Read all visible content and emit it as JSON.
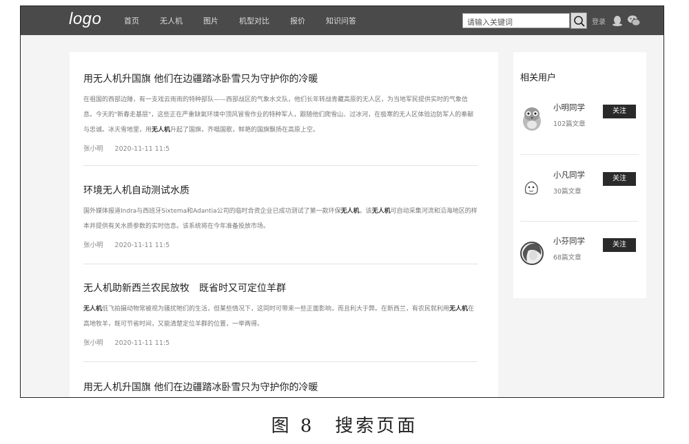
{
  "header": {
    "logo": "logo",
    "nav": [
      "首页",
      "无人机",
      "图片",
      "机型对比",
      "报价",
      "知识问答"
    ],
    "search_placeholder": "请输入关键词",
    "login": "登录"
  },
  "articles": [
    {
      "title": "用无人机升国旗 他们在边疆踏冰卧雪只为守护你的冷暖",
      "summary_html": "在祖国的西部边陲，有一支戏云雨雨的特种部队——西部战区的气象水文队，他们长年转战青藏高原的无人区，为当地军民提供实时的气象信息。今天的\"新春走基层\"，这些正在严重缺氧环境中顶风冒雪作业的特种军人，跟随他们爬雪山、过冰河，在极寒的无人区体验边防军人的奉献与忠诚。冰天雪地里，用<b>无人机</b>升起了国旗，齐唱国歌，鲜艳的国旗飘扬在高原上空。",
      "author": "张小明",
      "date": "2020-11-11 11:5"
    },
    {
      "title": "环境无人机自动测试水质",
      "summary_html": "国外媒体报道Indra与西班牙Sixtema和Adantia公司的临时合资企业已成功测试了第一款环保<b>无人机</b>，该<b>无人机</b>可自动采集河流和沿海地区的样本并提供有关水质参数的实时信息。该系统将在今年准备投放市场。",
      "author": "张小明",
      "date": "2020-11-11 11:5"
    },
    {
      "title": "无人机助新西兰农民放牧　既省时又可定位羊群",
      "summary_html": "<b>无人机</b>低飞拍摄动物常被视为骚扰牠们的生活，但某些情况下，这同时可带来一些正面影响，而且利大于弊。在新西兰，有农民就利用<b>无人机</b>在高地牧羊，既可节省时间，又能清楚定位羊群的位置，一举两得。",
      "author": "张小明",
      "date": "2020-11-11 11:5"
    },
    {
      "title": "用无人机升国旗 他们在边疆踏冰卧雪只为守护你的冷暖"
    }
  ],
  "sidebar": {
    "title": "相关用户",
    "follow_label": "关注",
    "users": [
      {
        "name": "小明同学",
        "count": "102篇文章"
      },
      {
        "name": "小凡同学",
        "count": "30篇文章"
      },
      {
        "name": "小芬同学",
        "count": "68篇文章"
      }
    ]
  },
  "caption": "图 8　搜索页面"
}
